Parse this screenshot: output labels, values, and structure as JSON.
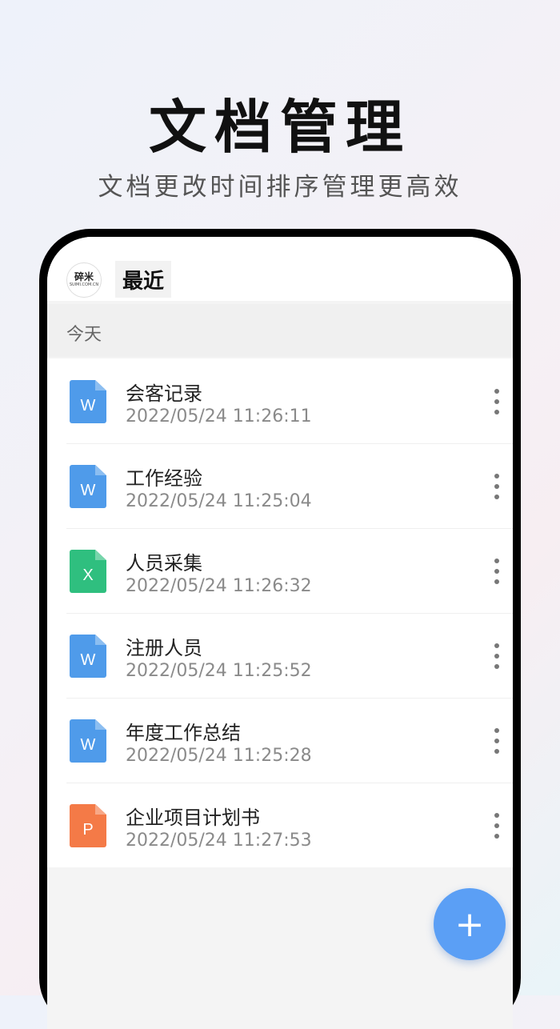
{
  "hero": {
    "title": "文档管理",
    "subtitle": "文档更改时间排序管理更高效"
  },
  "appbar": {
    "logo_main": "碎米",
    "logo_sub": "SUIMI.COM.CN",
    "title": "最近"
  },
  "section": {
    "label": "今天"
  },
  "files": [
    {
      "name": "会客记录",
      "date": "2022/05/24 11:26:11",
      "type": "W",
      "color": "#4f9bea"
    },
    {
      "name": "工作经验",
      "date": "2022/05/24 11:25:04",
      "type": "W",
      "color": "#4f9bea"
    },
    {
      "name": "人员采集",
      "date": "2022/05/24 11:26:32",
      "type": "X",
      "color": "#2fbf7f"
    },
    {
      "name": "注册人员",
      "date": "2022/05/24 11:25:52",
      "type": "W",
      "color": "#4f9bea"
    },
    {
      "name": "年度工作总结",
      "date": "2022/05/24 11:25:28",
      "type": "W",
      "color": "#4f9bea"
    },
    {
      "name": "企业项目计划书",
      "date": "2022/05/24 11:27:53",
      "type": "P",
      "color": "#f47a47"
    }
  ],
  "fab": {
    "icon": "plus-icon",
    "label": "+"
  }
}
